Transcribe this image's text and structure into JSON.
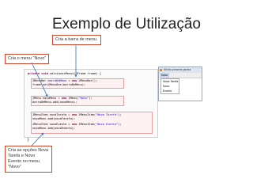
{
  "title": "Exemplo de Utilização",
  "callouts": {
    "menubar": "Cria a barra de menu.",
    "menu": "Cria o menu \"Novo\"",
    "items": "Cria as opções Nova Tarefa e Novo Evento no menu \"Novo\""
  },
  "code": {
    "l1_kw": "private void",
    "l1_rest": " adicionarMenus(JFrame frame) {",
    "l2_type": "JMenuBar",
    "l2_var": " barraDeMenu",
    "l2_eq": " = ",
    "l2_new": "new",
    "l2_rest": " JMenuBar();",
    "l3": "frame.setJMenuBar(barraDeMenu);",
    "l4_a": "JMenu novoMenu = ",
    "l4_new": "new",
    "l4_b": " JMenu(",
    "l4_str": "\"Novo\"",
    "l4_c": ");",
    "l5": "barraDeMenu.add(novoMenu);",
    "l6_a": "JMenuItem novaTarefa = ",
    "l6_new": "new",
    "l6_b": " JMenuItem(",
    "l6_str": "\"Nova Tarefa\"",
    "l6_c": ");",
    "l7": "novoMenu.add(novaTarefa);",
    "l8_a": "JMenuItem novoEvento = ",
    "l8_new": "new",
    "l8_b": " JMenuItem(",
    "l8_str": "\"Novo Evento\"",
    "l8_c": ");",
    "l9": "novoMenu.add(novoEvento);",
    "close": "}"
  },
  "window": {
    "title": "Minha primeira janela",
    "menu": "Novo",
    "items": [
      "Nova Tarefa",
      "Novo Evento"
    ]
  },
  "colors": {
    "callout_border": "#d0472a",
    "arrow": "#3a6fb5",
    "keyword": "#7f0055",
    "string": "#2a00ff"
  }
}
